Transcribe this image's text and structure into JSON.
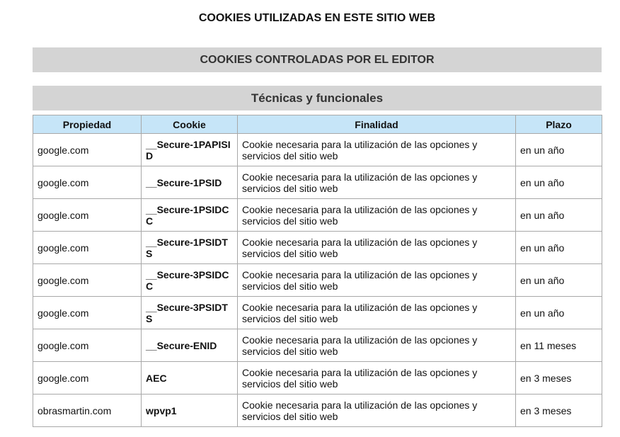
{
  "title": "COOKIES UTILIZADAS EN ESTE SITIO WEB",
  "section": "COOKIES CONTROLADAS POR EL EDITOR",
  "category": "Técnicas y funcionales",
  "columns": [
    "Propiedad",
    "Cookie",
    "Finalidad",
    "Plazo"
  ],
  "rows": [
    {
      "propiedad": "google.com",
      "cookie": "__Secure-1PAPISID",
      "finalidad": "Cookie necesaria para la utilización de las opciones y servicios del sitio web",
      "plazo": "en un año"
    },
    {
      "propiedad": "google.com",
      "cookie": "__Secure-1PSID",
      "finalidad": "Cookie necesaria para la utilización de las opciones y servicios del sitio web",
      "plazo": "en un año"
    },
    {
      "propiedad": "google.com",
      "cookie": "__Secure-1PSIDCC",
      "finalidad": "Cookie necesaria para la utilización de las opciones y servicios del sitio web",
      "plazo": "en un año"
    },
    {
      "propiedad": "google.com",
      "cookie": "__Secure-1PSIDTS",
      "finalidad": "Cookie necesaria para la utilización de las opciones y servicios del sitio web",
      "plazo": "en un año"
    },
    {
      "propiedad": "google.com",
      "cookie": "__Secure-3PSIDCC",
      "finalidad": "Cookie necesaria para la utilización de las opciones y servicios del sitio web",
      "plazo": "en un año"
    },
    {
      "propiedad": "google.com",
      "cookie": "__Secure-3PSIDTS",
      "finalidad": "Cookie necesaria para la utilización de las opciones y servicios del sitio web",
      "plazo": "en un año"
    },
    {
      "propiedad": "google.com",
      "cookie": "__Secure-ENID",
      "finalidad": "Cookie necesaria para la utilización de las opciones y servicios del sitio web",
      "plazo": "en 11 meses"
    },
    {
      "propiedad": "google.com",
      "cookie": "AEC",
      "finalidad": "Cookie necesaria para la utilización de las opciones y servicios del sitio web",
      "plazo": "en 3 meses"
    },
    {
      "propiedad": "obrasmartin.com",
      "cookie": "wpvp1",
      "finalidad": "Cookie necesaria para la utilización de las opciones y servicios del sitio web",
      "plazo": "en 3 meses"
    }
  ]
}
